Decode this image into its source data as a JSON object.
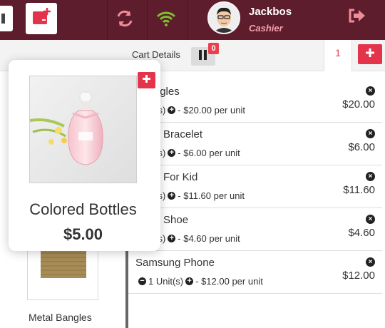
{
  "header": {
    "user_name": "Jackbos",
    "user_role": "Cashier",
    "colors": {
      "bar": "#5e1d2d",
      "accent": "#e3344c",
      "wifi": "#7bbf2e"
    },
    "icons": [
      "new-tab-icon",
      "refresh-icon",
      "wifi-icon",
      "avatar",
      "logout-icon"
    ]
  },
  "cart_header": {
    "label": "Cart Details",
    "paused_count": "0",
    "active_tab": "1"
  },
  "cart_items": [
    {
      "name": "Metal Bangles",
      "visible_name": "l Bangles",
      "visible_qty": "Unit(s)",
      "price_text": "- $20.00 per unit",
      "total": "$20.00"
    },
    {
      "name": "Bracelet",
      "visible_name": "Bracelet",
      "visible_qty": "Unit(s)",
      "price_text": "- $6.00 per unit",
      "total": "$6.00"
    },
    {
      "name": "For Kid",
      "visible_name": "For Kid",
      "visible_qty": "Unit(s)",
      "price_text": "- $11.60 per unit",
      "total": "$11.60"
    },
    {
      "name": "Shoe",
      "visible_name": "Shoe",
      "visible_qty": "Unit(s)",
      "price_text": "- $4.60 per unit",
      "total": "$4.60"
    },
    {
      "name": "Samsung Phone",
      "visible_name": "Samsung Phone",
      "visible_qty": "1 Unit(s)",
      "price_text": "- $12.00 per unit",
      "total": "$12.00"
    }
  ],
  "product_popup": {
    "name": "Colored Bottles",
    "price": "$5.00"
  },
  "product_grid": {
    "thumb_name": "Metal Bangles"
  }
}
